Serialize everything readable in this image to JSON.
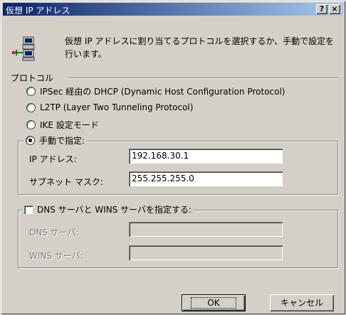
{
  "window": {
    "title": "仮想 IP アドレス",
    "help_label": "?",
    "close_label": "×"
  },
  "icons": {
    "network": "network-computers-icon"
  },
  "description": "仮想 IP アドレスに割り当てるプロトコルを選択するか、手動で設定を行います。",
  "protocol": {
    "section_label": "プロトコル",
    "options": [
      {
        "label": "IPSec 経由の DHCP (Dynamic Host Configuration Protocol)",
        "checked": false
      },
      {
        "label": "L2TP (Layer Two Tunneling Protocol)",
        "checked": false
      },
      {
        "label": "IKE 設定モード",
        "checked": false
      }
    ],
    "manual": {
      "label": "手動で指定:",
      "checked": true,
      "ip_label": "IP アドレス:",
      "ip_value": "192.168.30.1",
      "subnet_label": "サブネット マスク:",
      "subnet_value": "255.255.255.0"
    }
  },
  "dns_wins": {
    "label": "DNS サーバと WINS サーバを指定する:",
    "checked": false,
    "dns_label": "DNS サーバ:",
    "dns_value": "",
    "wins_label": "WINS サーバ:",
    "wins_value": ""
  },
  "buttons": {
    "ok": "OK",
    "cancel": "キャンセル"
  },
  "colors": {
    "titlebar_start": "#0a246a",
    "titlebar_end": "#a6caf0",
    "face": "#d4d0c8"
  }
}
